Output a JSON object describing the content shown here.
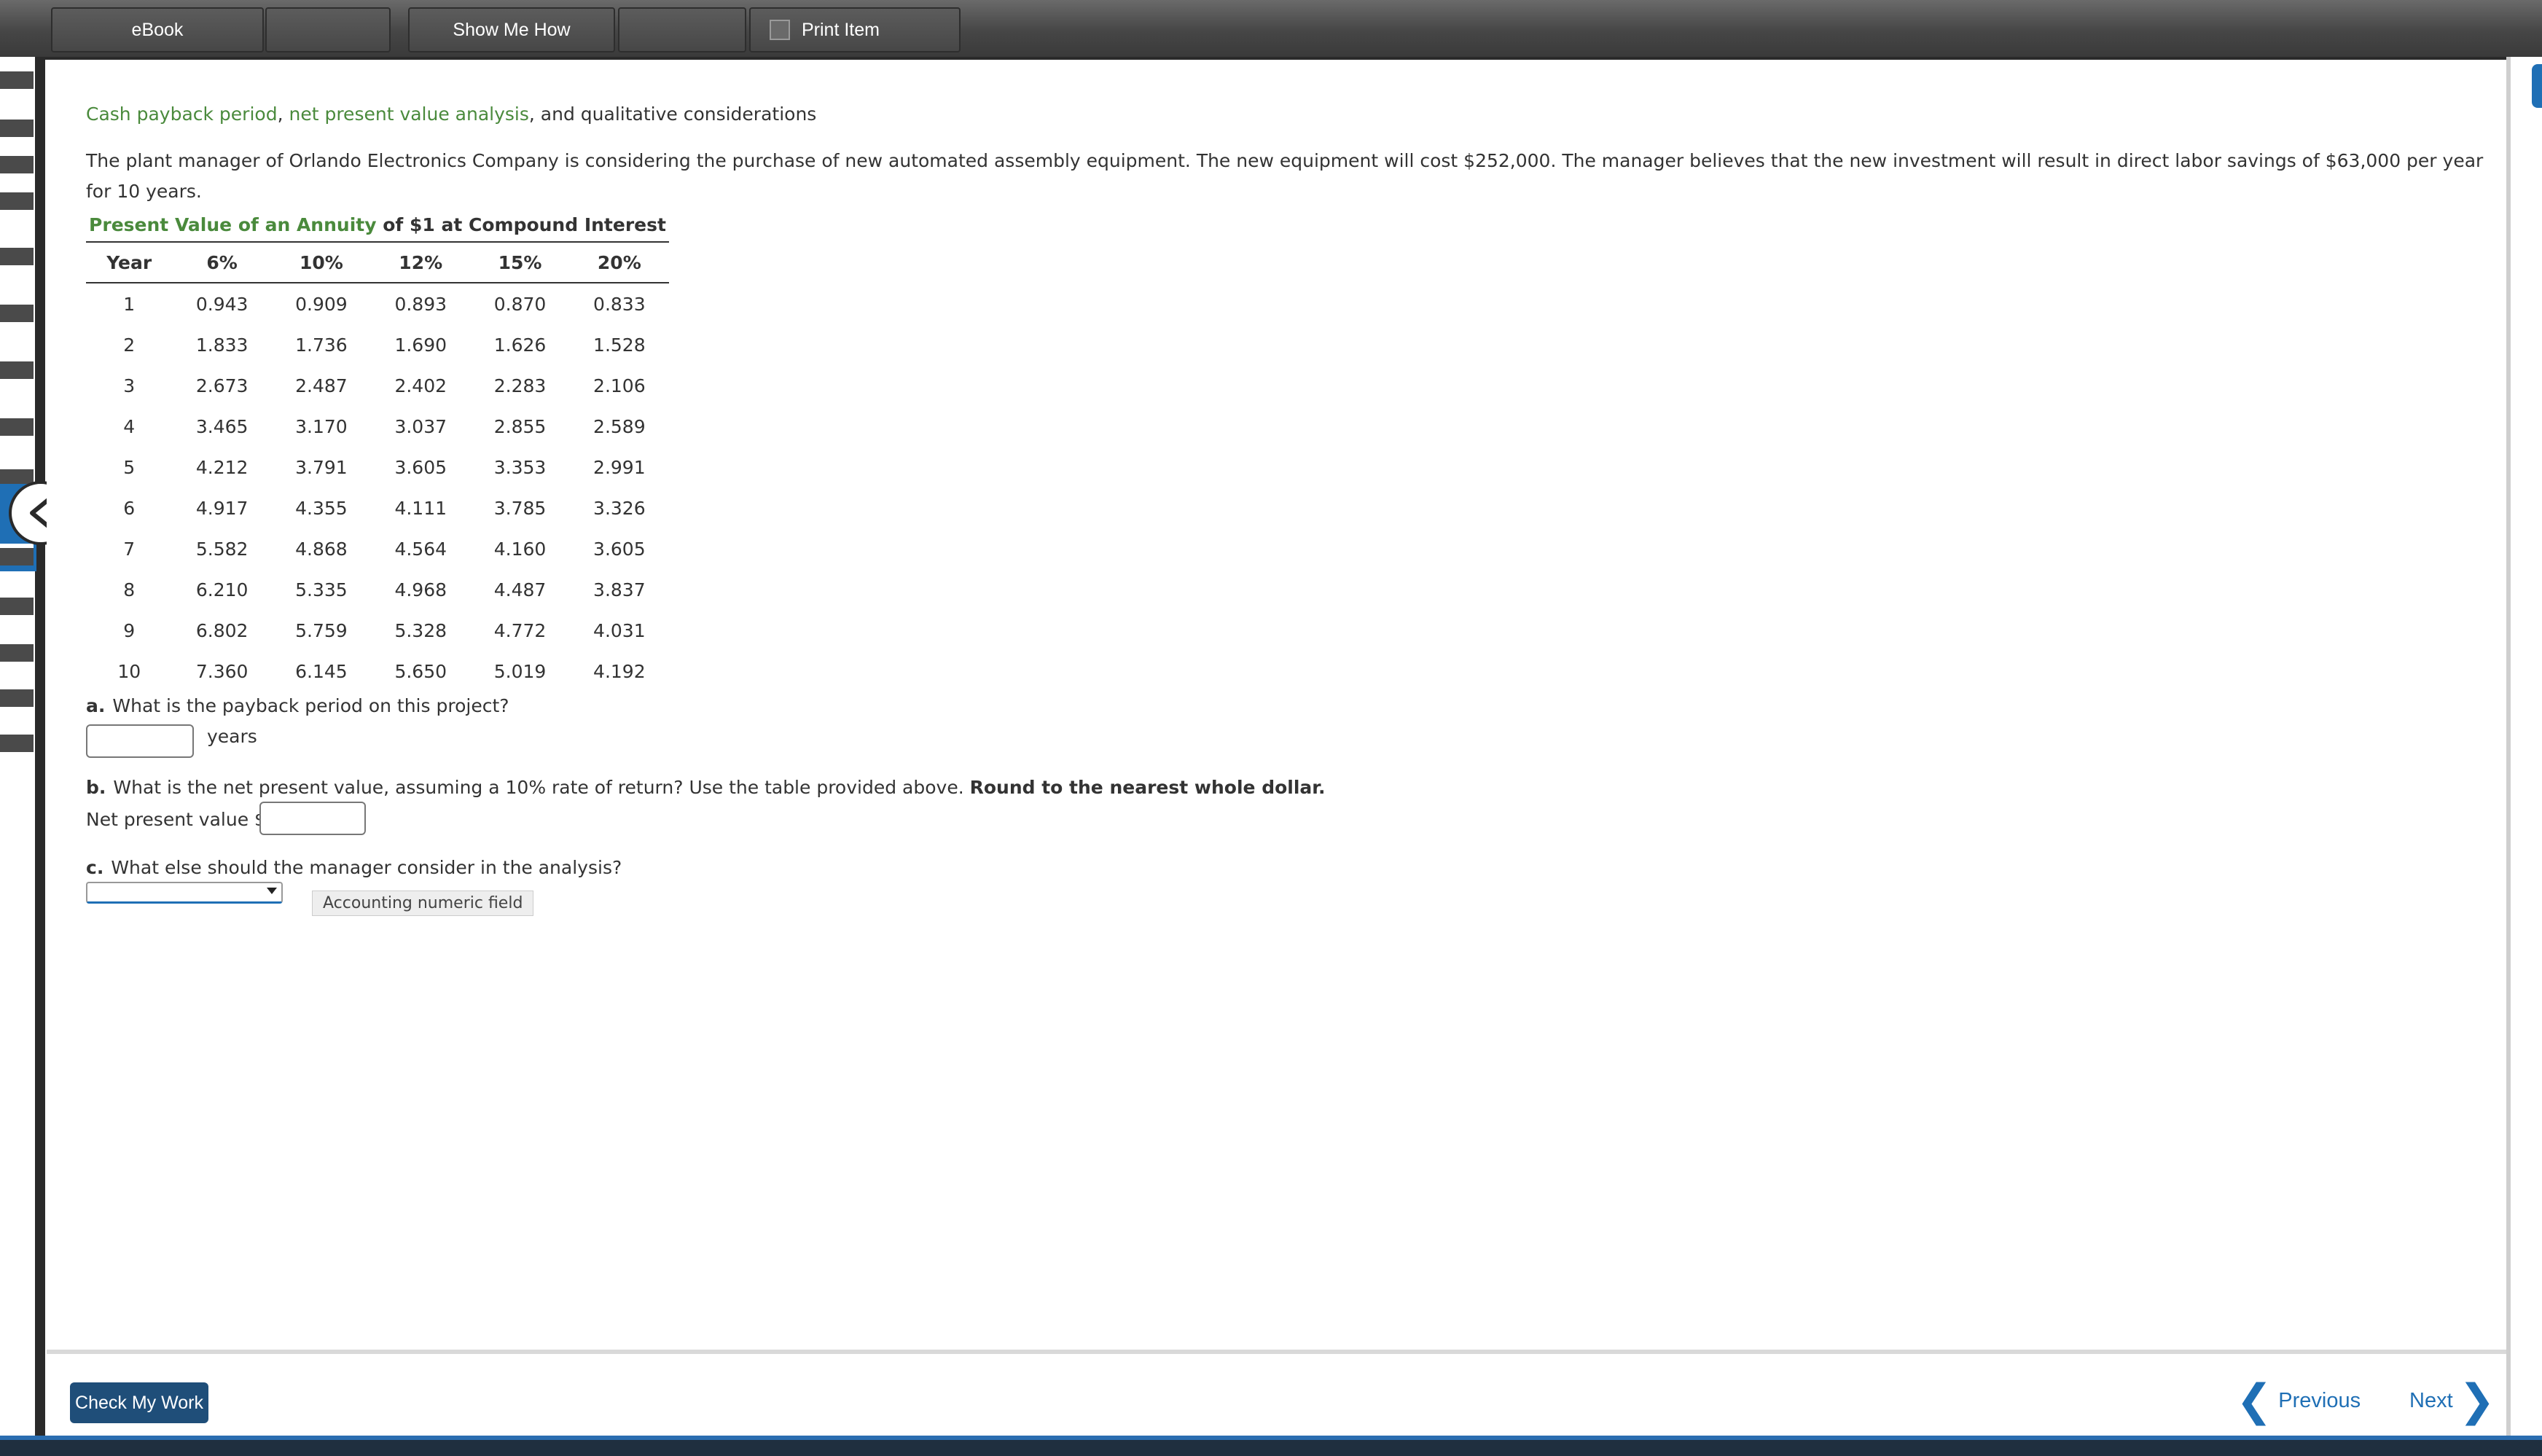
{
  "toolbar": {
    "ebook": "eBook",
    "show_me_how": "Show Me How",
    "print_item": "Print Item"
  },
  "topic": {
    "part1": "Cash payback period",
    "sep1": ", ",
    "part2": "net present value analysis",
    "rest": ", and qualitative considerations"
  },
  "prompt": "The plant manager of Orlando Electronics Company is considering the purchase of new automated assembly equipment. The new equipment will cost $252,000. The manager believes that the new investment will result in direct labor savings of $63,000 per year for 10 years.",
  "table": {
    "caption_green": "Present Value of an Annuity",
    "caption_rest": " of $1 at Compound Interest",
    "headers": [
      "Year",
      "6%",
      "10%",
      "12%",
      "15%",
      "20%"
    ],
    "rows": [
      [
        "1",
        "0.943",
        "0.909",
        "0.893",
        "0.870",
        "0.833"
      ],
      [
        "2",
        "1.833",
        "1.736",
        "1.690",
        "1.626",
        "1.528"
      ],
      [
        "3",
        "2.673",
        "2.487",
        "2.402",
        "2.283",
        "2.106"
      ],
      [
        "4",
        "3.465",
        "3.170",
        "3.037",
        "2.855",
        "2.589"
      ],
      [
        "5",
        "4.212",
        "3.791",
        "3.605",
        "3.353",
        "2.991"
      ],
      [
        "6",
        "4.917",
        "4.355",
        "4.111",
        "3.785",
        "3.326"
      ],
      [
        "7",
        "5.582",
        "4.868",
        "4.564",
        "4.160",
        "3.605"
      ],
      [
        "8",
        "6.210",
        "5.335",
        "4.968",
        "4.487",
        "3.837"
      ],
      [
        "9",
        "6.802",
        "5.759",
        "5.328",
        "4.772",
        "4.031"
      ],
      [
        "10",
        "7.360",
        "6.145",
        "5.650",
        "5.019",
        "4.192"
      ]
    ]
  },
  "questions": {
    "a_label": "a.",
    "a_text": "What is the payback period on this project?",
    "a_value": "",
    "a_unit": "years",
    "b_label": "b.",
    "b_text": "What is the net present value, assuming a 10% rate of return? Use the table provided above.",
    "b_bold": "Round to the nearest whole dollar.",
    "b_field_label": "Net present value $",
    "b_value": "",
    "tooltip": "Accounting numeric field",
    "c_label": "c.",
    "c_text": "What else should the manager consider in the analysis?",
    "c_selected": ""
  },
  "footer": {
    "check": "Check My Work",
    "previous": "Previous",
    "next": "Next"
  },
  "colors": {
    "accent_blue": "#1f6fb5",
    "topic_green": "#4a8a3c",
    "check_button": "#1f4e79"
  }
}
